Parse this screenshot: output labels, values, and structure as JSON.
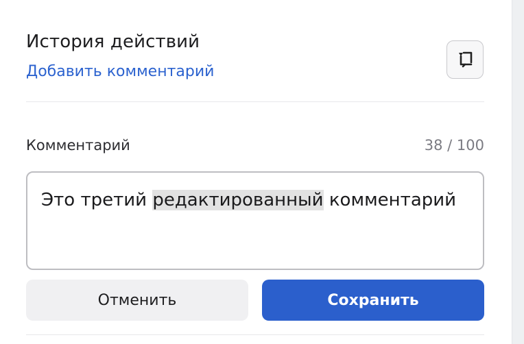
{
  "header": {
    "title": "История действий",
    "add_comment_link": "Добавить комментарий",
    "toggle_icon": "comment-arrow-icon"
  },
  "comment_form": {
    "label": "Комментарий",
    "counter": "38 / 100",
    "text_before_selection": "Это третий ",
    "selected_text": "редактированный",
    "text_after_selection": " комментарий",
    "cancel_label": "Отменить",
    "save_label": "Сохранить"
  },
  "colors": {
    "accent": "#2b5fcc",
    "link": "#2b62cf",
    "cancel_bg": "#f0f0f2",
    "border": "#bdbdc1",
    "selection": "#e2e2e2"
  }
}
